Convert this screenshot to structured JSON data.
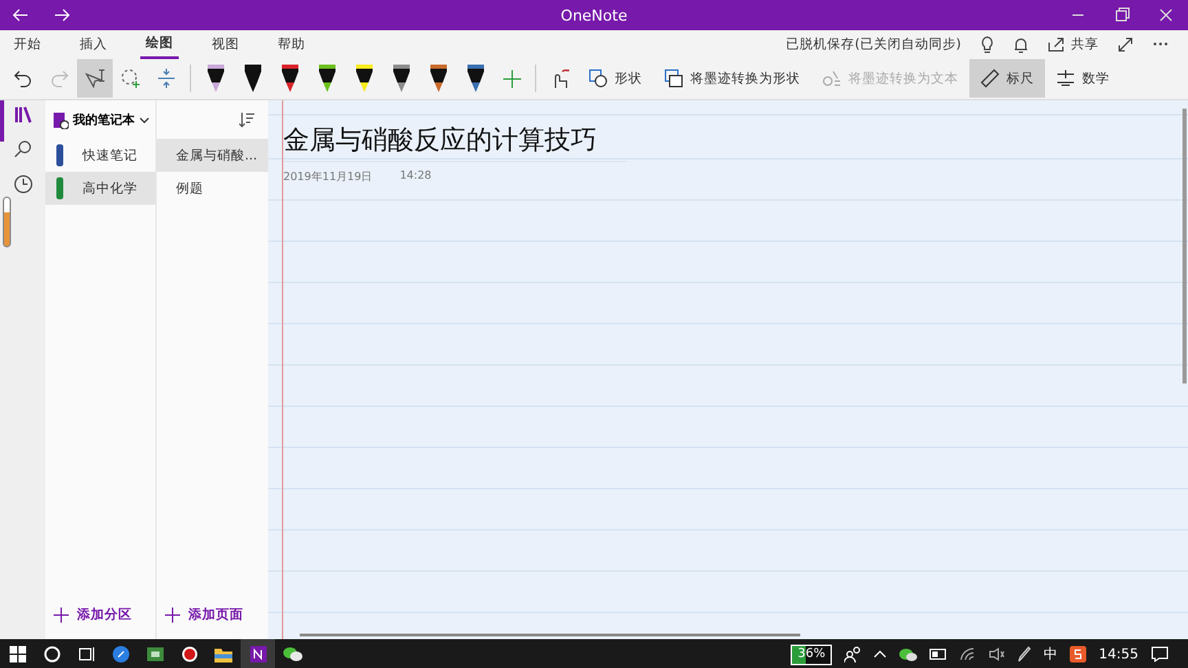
{
  "title_bar": {
    "title": "OneNote"
  },
  "menu_tabs": [
    {
      "label": "开始",
      "selected": false
    },
    {
      "label": "插入",
      "selected": false
    },
    {
      "label": "绘图",
      "selected": true
    },
    {
      "label": "视图",
      "selected": false
    },
    {
      "label": "帮助",
      "selected": false
    }
  ],
  "sync_status": "已脱机保存(已关闭自动同步)",
  "share_label": "共享",
  "pens": [
    {
      "color": "#c9a8d8"
    },
    {
      "color": "#111111"
    },
    {
      "color": "#d8232a"
    },
    {
      "color": "#6cc01c"
    },
    {
      "color": "#f7ec1e"
    },
    {
      "color": "#8c8c8c"
    },
    {
      "color": "#c86a2a"
    },
    {
      "color": "#3a6fb0"
    }
  ],
  "tool_buttons": [
    {
      "kind": "shape",
      "label": "形状",
      "disabled": false,
      "selected": false
    },
    {
      "kind": "ink-to-shape",
      "label": "将墨迹转换为形状",
      "disabled": false,
      "selected": false
    },
    {
      "kind": "ink-to-text",
      "label": "将墨迹转换为文本",
      "disabled": true,
      "selected": false
    },
    {
      "kind": "ruler",
      "label": "标尺",
      "disabled": false,
      "selected": true
    },
    {
      "kind": "math",
      "label": "数学",
      "disabled": false,
      "selected": false
    }
  ],
  "notebook": {
    "name": "我的笔记本",
    "sections": [
      {
        "label": "快速笔记",
        "color": "#2b4f9a",
        "selected": false
      },
      {
        "label": "高中化学",
        "color": "#1f8a3c",
        "selected": true
      }
    ],
    "pages": [
      {
        "label": "金属与硝酸...",
        "selected": true
      },
      {
        "label": "例题",
        "selected": false
      }
    ],
    "add_section": "添加分区",
    "add_page": "添加页面"
  },
  "page": {
    "title": "金属与硝酸反应的计算技巧",
    "date": "2019年11月19日",
    "time": "14:28"
  },
  "taskbar": {
    "battery": "36%",
    "ime": "中",
    "clock": "14:55"
  }
}
